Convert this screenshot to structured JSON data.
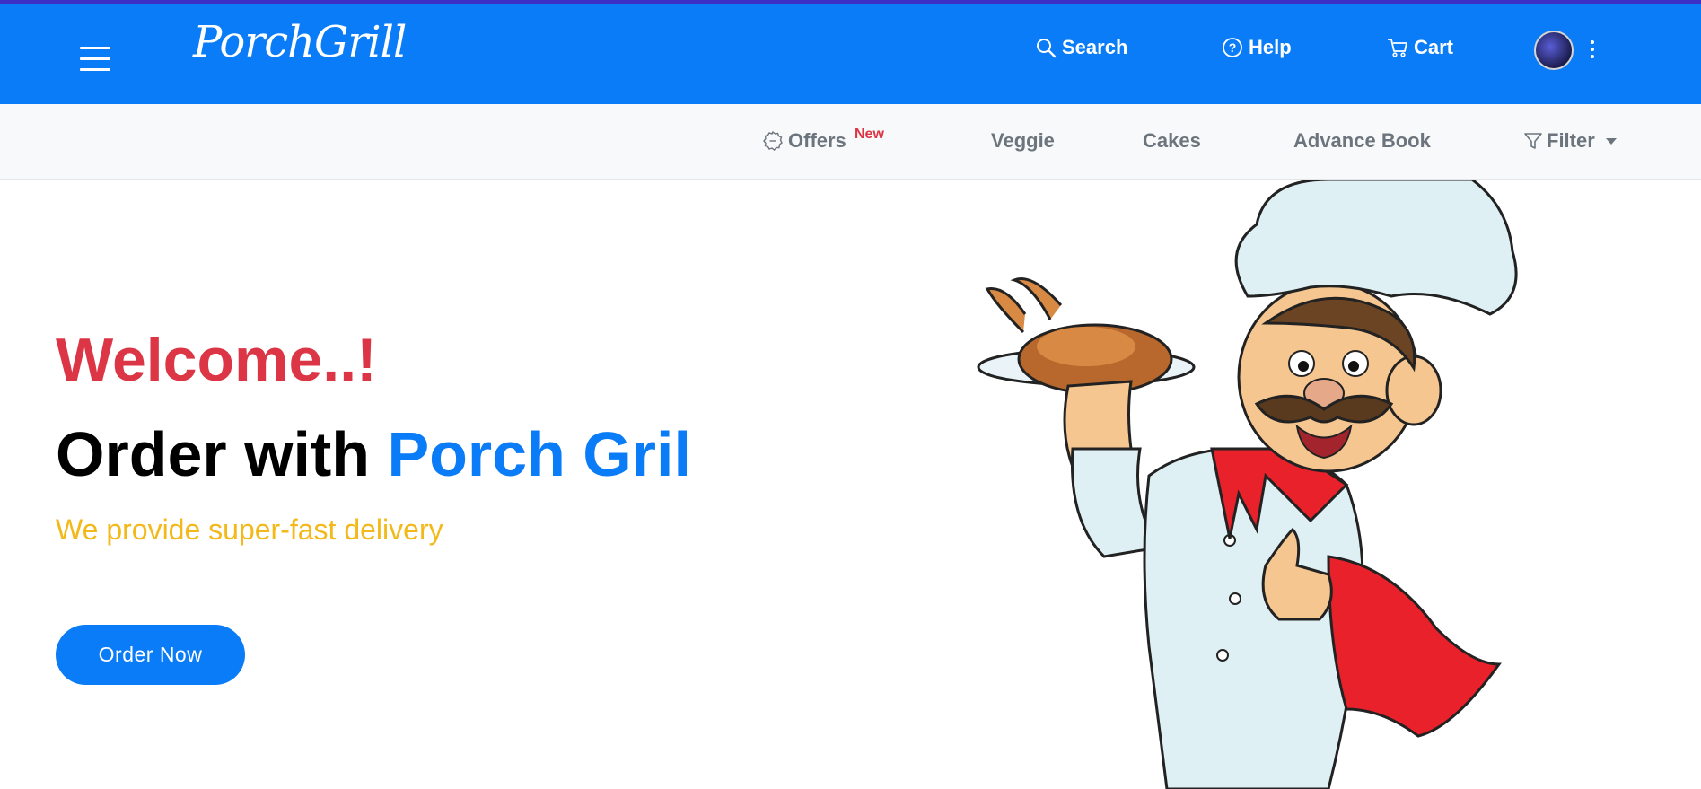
{
  "navbar": {
    "brand": "PorchGrill",
    "links": {
      "search": "Search",
      "help": "Help",
      "cart": "Cart"
    },
    "background_color": "#0a7cf7"
  },
  "subnav": {
    "offers": "Offers",
    "offers_badge": "New",
    "veggie": "Veggie",
    "cakes": "Cakes",
    "advance_book": "Advance Book",
    "filter": "Filter"
  },
  "hero": {
    "welcome": "Welcome..!",
    "title_prefix": "Order with ",
    "title_accent": "Porch Gril",
    "subtitle": "We provide super-fast delivery",
    "order_button": "Order Now"
  },
  "colors": {
    "primary": "#0a7cf7",
    "welcome": "#dc3545",
    "subtitle": "#f3b91a",
    "badge": "#dc3545"
  },
  "icons": {
    "menu": "hamburger-icon",
    "search": "search-icon",
    "help": "question-circle-icon",
    "cart": "cart-icon",
    "more": "kebab-icon",
    "offers": "discount-icon",
    "filter": "funnel-icon",
    "dropdown": "caret-down-icon"
  }
}
